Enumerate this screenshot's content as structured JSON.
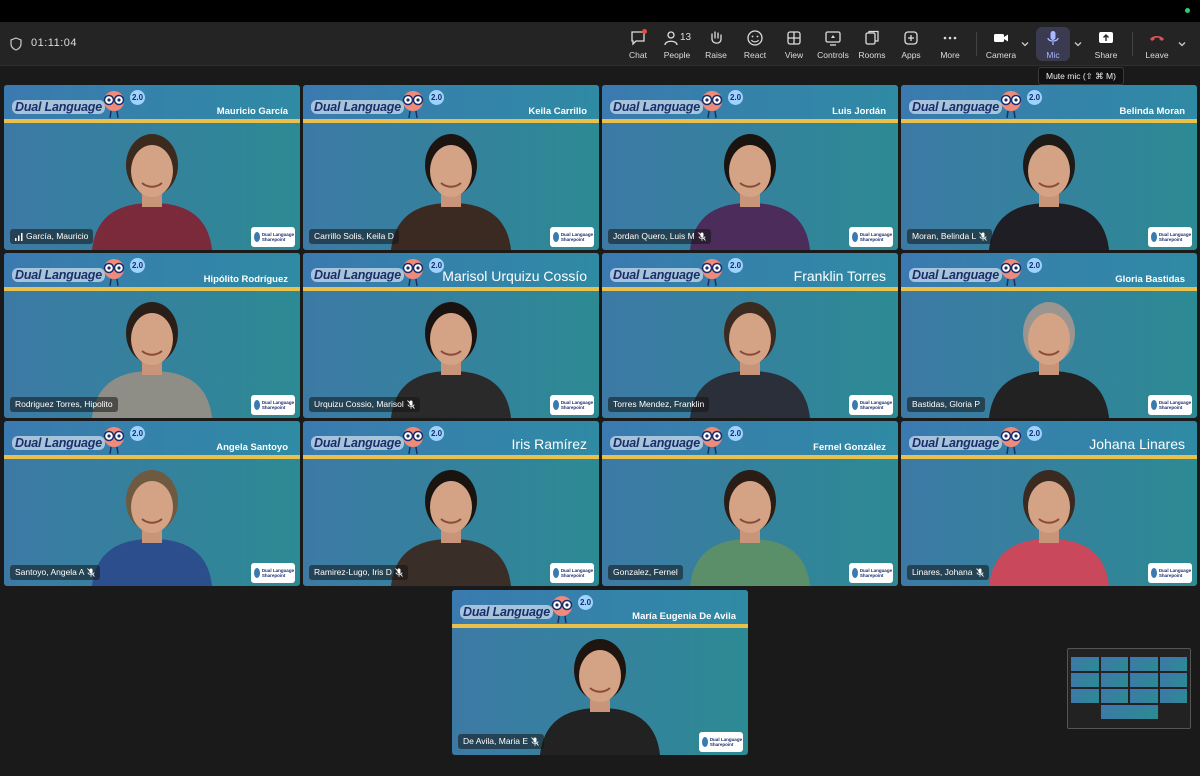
{
  "meeting": {
    "timer": "01:11:04",
    "participant_count": "13"
  },
  "toolbar": {
    "chat": "Chat",
    "people": "People",
    "raise": "Raise",
    "react": "React",
    "view": "View",
    "controls": "Controls",
    "rooms": "Rooms",
    "apps": "Apps",
    "more": "More",
    "camera": "Camera",
    "mic": "Mic",
    "share": "Share",
    "leave": "Leave"
  },
  "tooltip": "Mute mic (⇧ ⌘ M)",
  "background": {
    "brand": "Dual Language",
    "version": "2.0",
    "logo_text": "Dual Language Sharepoint"
  },
  "tiles": [
    {
      "banner": "Mauricio García",
      "name": "García, Mauricio",
      "muted": false,
      "signal": true
    },
    {
      "banner": "Keila Carrillo",
      "name": "Carrillo Solis, Keila D",
      "muted": false
    },
    {
      "banner": "Luis Jordán",
      "name": "Jordan Quero, Luis M",
      "muted": true
    },
    {
      "banner": "Belinda Moran",
      "name": "Moran, Belinda L",
      "muted": true
    },
    {
      "banner": "Hipólito Rodríguez",
      "name": "Rodriguez Torres, Hipolito",
      "muted": false
    },
    {
      "banner": "Marisol Urquizu Cossío",
      "name": "Urquizu Cossio, Marisol",
      "muted": true,
      "big": true
    },
    {
      "banner": "Franklin Torres",
      "name": "Torres Mendez, Franklin",
      "muted": false,
      "big": true
    },
    {
      "banner": "Gloria Bastidas",
      "name": "Bastidas, Gloria P",
      "muted": false
    },
    {
      "banner": "Angela Santoyo",
      "name": "Santoyo, Angela A",
      "muted": true
    },
    {
      "banner": "Iris Ramírez",
      "name": "Ramirez-Lugo, Iris D",
      "muted": true,
      "big": true
    },
    {
      "banner": "Fernel González",
      "name": "Gonzalez, Fernel",
      "muted": false
    },
    {
      "banner": "Johana Linares",
      "name": "Linares, Johana",
      "muted": true,
      "big": true
    },
    {
      "banner": "María Eugenia De Avila",
      "name": "De Avila, Maria E",
      "muted": true
    }
  ]
}
